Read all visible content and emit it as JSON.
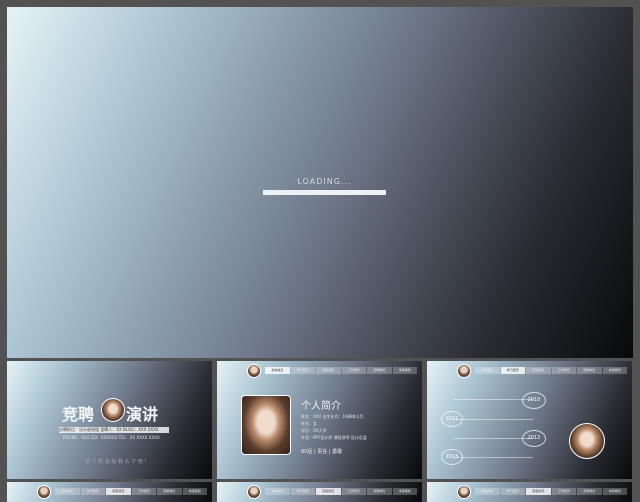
{
  "main": {
    "loading_text": "LOADING...",
    "progress": 1.0
  },
  "thumb_nav_labels": [
    "基本信息",
    "学习经历",
    "获奖情况",
    "工作经历",
    "竞聘岗位",
    "未来规划"
  ],
  "thumb1": {
    "title_left": "竞聘",
    "title_right": "演讲",
    "info_line1": "应聘职位：设计部经理   竞聘人：XX   BLOG：XXX XXXX",
    "info_line2": "PHONE：XXX   QQ：XXXXXX   TEL：XX XXXX XXXX",
    "slogan": "给 个 机 会 给 我 么 下 吧 !"
  },
  "thumb2": {
    "heading": "个人简介",
    "details": [
      "姓名：XXX   出生年月：1988年1月",
      "性别：女",
      "学历：XX大学",
      "专业：PPT设计师   课程讲师   设计总监"
    ],
    "tags": "80后 | 责任 | 勇敢"
  },
  "thumb3": {
    "years": [
      "2010",
      "2011",
      "2012",
      "2013"
    ]
  }
}
